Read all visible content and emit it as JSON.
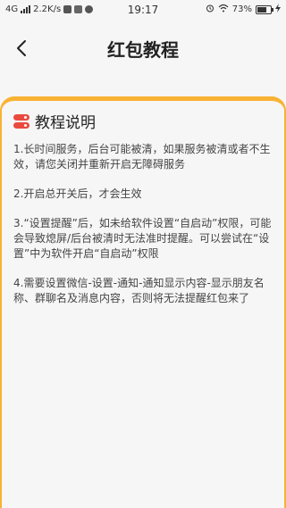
{
  "status_bar": {
    "network": "4G",
    "speed": "2.2K/s",
    "time": "19:17",
    "battery": "73%",
    "battery_level": 0.73
  },
  "nav": {
    "title": "红包教程"
  },
  "section": {
    "title": "教程说明"
  },
  "tips": [
    "1.长时间服务，后台可能被清，如果服务被清或者不生效，请您关闭并重新开启无障碍服务",
    "2.开启总开关后，才会生效",
    "3.“设置提醒”后，如未给软件设置“自启动”权限，可能会导致熄屏/后台被清时无法准时提醒。可以尝试在“设置”中为软件开启“自启动”权限",
    "4.需要设置微信-设置-通知-通知显示内容-显示朋友名称、群聊名及消息内容，否则将无法提醒红包来了"
  ],
  "colors": {
    "accent": "#f9b233",
    "icon_red": "#e94a3f",
    "background": "#f6f6f6"
  }
}
